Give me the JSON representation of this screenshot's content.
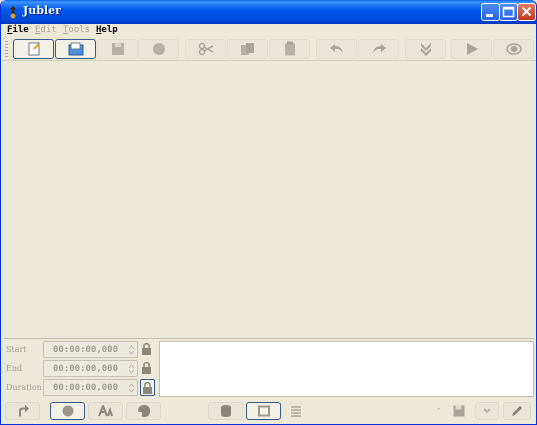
{
  "window": {
    "title": "Jubler"
  },
  "menu": {
    "items": [
      {
        "label": "File",
        "enabled": true
      },
      {
        "label": "Edit",
        "enabled": false
      },
      {
        "label": "Tools",
        "enabled": false
      },
      {
        "label": "Help",
        "enabled": true
      }
    ]
  },
  "toolbar": {
    "icons": [
      "new-file-icon",
      "open-file-icon",
      "save-icon",
      "info-icon",
      "cut-icon",
      "copy-icon",
      "paste-icon",
      "undo-icon",
      "redo-icon",
      "jump-down-icon",
      "play-icon",
      "preview-icon"
    ]
  },
  "timing": {
    "start_label": "Start",
    "end_label": "End",
    "duration_label": "Duration",
    "start_value": "00:00:00,000",
    "end_value": "00:00:00,000",
    "duration_value": "00:00:00,000"
  },
  "statusbar": {
    "separator": "-"
  },
  "colors": {
    "title_bar": "#0058ee",
    "background": "#ece9d8",
    "active_border": "#3a5a8c",
    "disabled_text": "#a09d8e"
  }
}
